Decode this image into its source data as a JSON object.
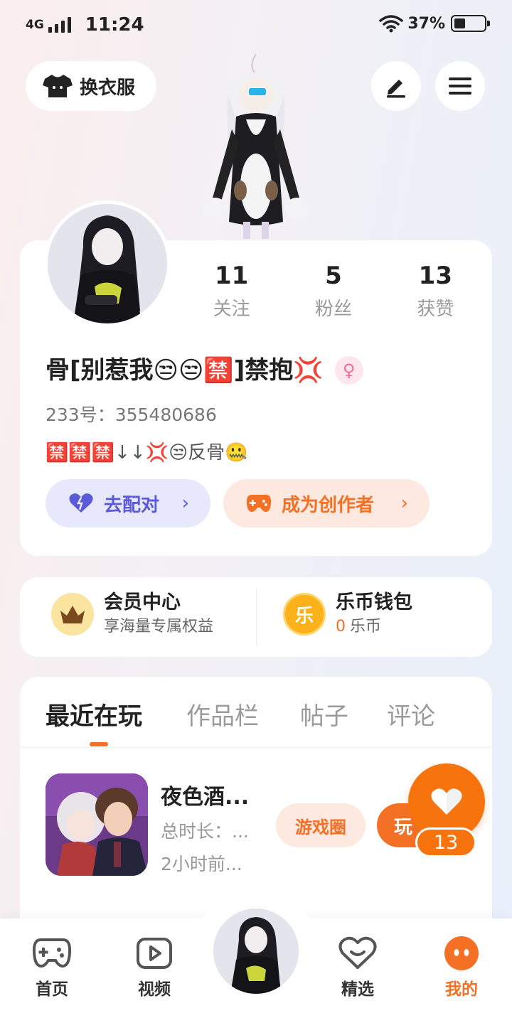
{
  "status_bar": {
    "network": "4G",
    "time": "11:24",
    "battery": "37%",
    "battery_level": 0.37,
    "icons": [
      "signal-icon",
      "wifi-icon",
      "battery-icon"
    ]
  },
  "top": {
    "dress_label": "换衣服",
    "icons": [
      "shirt-icon",
      "edit-icon",
      "menu-icon"
    ]
  },
  "profile": {
    "stats": [
      {
        "num": "11",
        "label": "关注"
      },
      {
        "num": "5",
        "label": "粉丝"
      },
      {
        "num": "13",
        "label": "获赞"
      }
    ],
    "nickname": "骨[别惹我😒😒🈲]禁抱💢",
    "gender_symbol": "♀",
    "id_line": "233号：355480686",
    "bio": "🈲🈲🈲↓↓💢😒反骨🤐",
    "match_label": "去配对",
    "creator_label": "成为创作者",
    "arrow": "›"
  },
  "wallet": {
    "vip_title": "会员中心",
    "vip_sub": "享海量专属权益",
    "coin_title": "乐币钱包",
    "coin_amount": "0",
    "coin_unit": "乐币",
    "coin_glyph": "乐"
  },
  "tabs": [
    "最近在玩",
    "作品栏",
    "帖子",
    "评论"
  ],
  "game": {
    "title": "夜色酒...",
    "duration": "总时长：...",
    "time_ago": "2小时前...",
    "circle_label": "游戏圈",
    "play_label": "玩"
  },
  "like": {
    "count": "13"
  },
  "nav": [
    {
      "label": "首页",
      "icon": "gamepad-icon"
    },
    {
      "label": "视频",
      "icon": "video-icon"
    },
    {
      "label": "精选",
      "icon": "heart-badge-icon"
    },
    {
      "label": "我的",
      "icon": "profile-dots-icon",
      "active": true
    }
  ],
  "colors": {
    "accent": "#f47025",
    "match": "#5a5ad8",
    "like": "#f7730e"
  }
}
